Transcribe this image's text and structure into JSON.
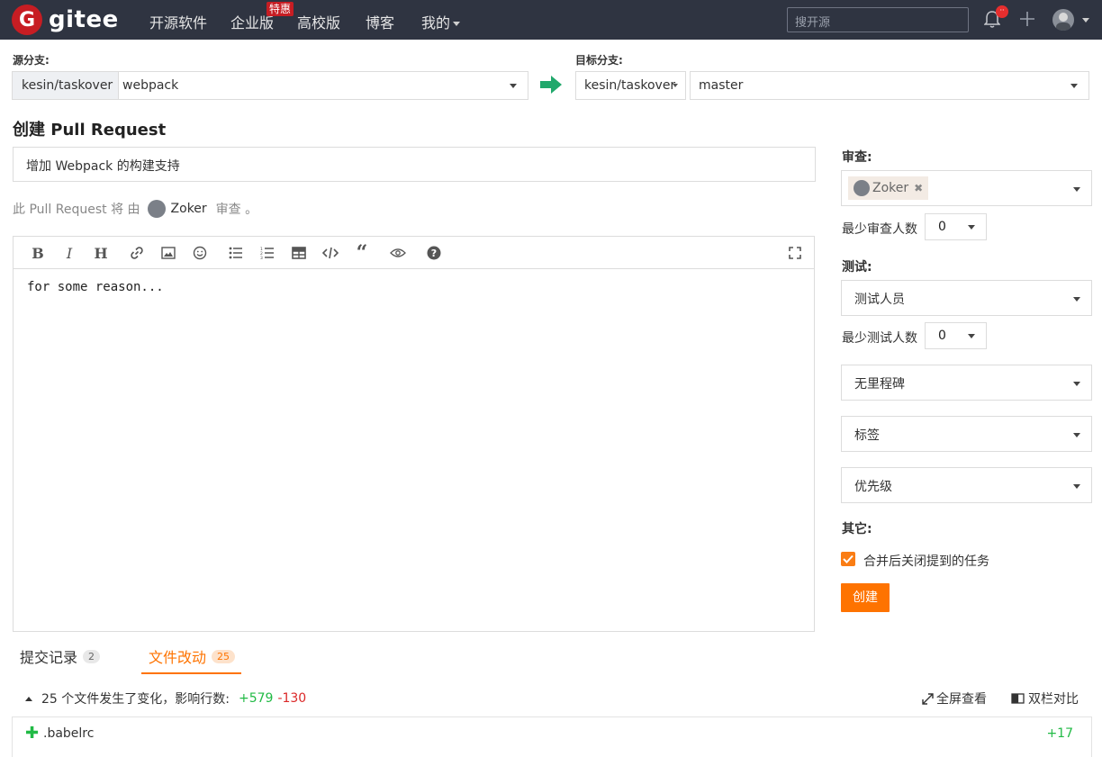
{
  "nav": {
    "logo_letter": "G",
    "logo_text": "gitee",
    "items": [
      "开源软件",
      "企业版",
      "高校版",
      "博客",
      "我的"
    ],
    "enterprise_badge": "特惠",
    "search_placeholder": "搜开源",
    "bell_badge": "··"
  },
  "source": {
    "label": "源分支:",
    "repo": "kesin/taskover",
    "branch": "webpack"
  },
  "target": {
    "label": "目标分支:",
    "repo": "kesin/taskover",
    "branch": "master"
  },
  "page_title": "创建 Pull Request",
  "pr_title_value": "增加 Webpack 的构建支持",
  "review_line": {
    "prefix": "此 Pull Request 将 由",
    "reviewer": "Zoker",
    "suffix": "审查 。"
  },
  "editor": {
    "content": "for some reason..."
  },
  "sidebar": {
    "review_label": "审查:",
    "reviewer_tag": "Zoker",
    "min_reviewers_label": "最少审查人数",
    "min_reviewers_value": "0",
    "test_label": "测试:",
    "tester_placeholder": "测试人员",
    "min_testers_label": "最少测试人数",
    "min_testers_value": "0",
    "milestone": "无里程碑",
    "tags": "标签",
    "priority": "优先级",
    "other_label": "其它:",
    "close_issues_label": "合并后关闭提到的任务",
    "close_issues_checked": true,
    "create_button": "创建"
  },
  "tabs": [
    {
      "label": "提交记录",
      "count": "2"
    },
    {
      "label": "文件改动",
      "count": "25"
    }
  ],
  "summary": {
    "text": "25 个文件发生了变化，影响行数:",
    "additions": "+579",
    "deletions": "-130"
  },
  "actions": {
    "fullscreen": "全屏查看",
    "split": "双栏对比"
  },
  "files": [
    {
      "name": ".babelrc",
      "additions": "+17"
    }
  ],
  "colors": {
    "nav_bg": "#2f3441",
    "brand_red": "#c71d23",
    "accent_orange": "#fe7300",
    "add_green": "#21ba45",
    "del_red": "#db2828"
  }
}
